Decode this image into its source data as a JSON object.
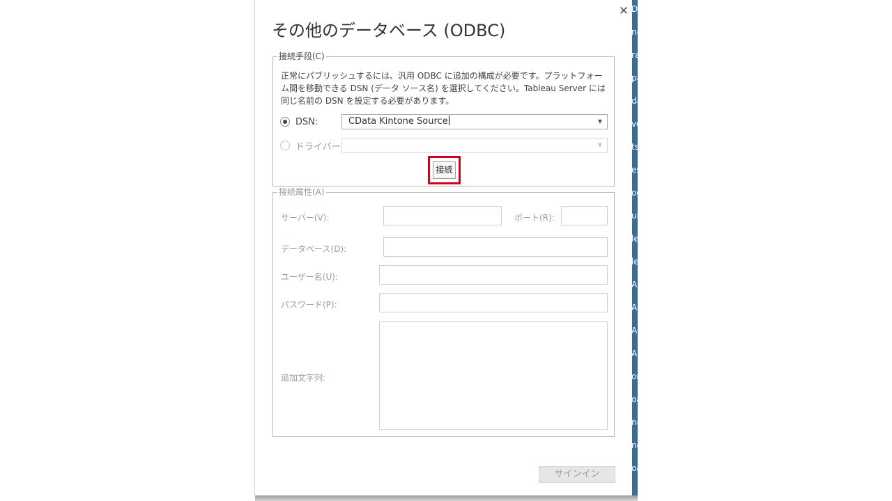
{
  "dialog": {
    "title": "その他のデータベース (ODBC)",
    "close_icon": "close-icon",
    "connection_group": {
      "label": "接続手段(C)",
      "description": "正常にパブリッシュするには、汎用 ODBC に追加の構成が必要です。プラットフォーム間を移動できる DSN (データ ソース名) を選択してください。Tableau Server には同じ名前の DSN を設定する必要があります。",
      "dsn_label": "DSN:",
      "dsn_value": "CData Kintone Source",
      "dsn_selected": true,
      "driver_label": "ドライバー:",
      "driver_value": "",
      "connect_button": "接続",
      "highlight_color": "#d0021b"
    },
    "attributes_group": {
      "label": "接続属性(A)",
      "server_label": "サーバー(V):",
      "port_label": "ポート(R):",
      "database_label": "データベース(D):",
      "username_label": "ユーザー名(U):",
      "password_label": "パスワード(P):",
      "extra_label": "追加文字列:"
    },
    "signin_button": "サインイン"
  },
  "background": {
    "strip_color": "#3a6d96",
    "items": [
      "Da",
      "ne",
      "ra",
      "pa",
      "da",
      "vo",
      "ts",
      "es",
      "og",
      "ub",
      "le",
      "le",
      "AP",
      "AP",
      "AP",
      "AP",
      "or",
      "oa",
      "ng",
      "no",
      "oa"
    ]
  }
}
